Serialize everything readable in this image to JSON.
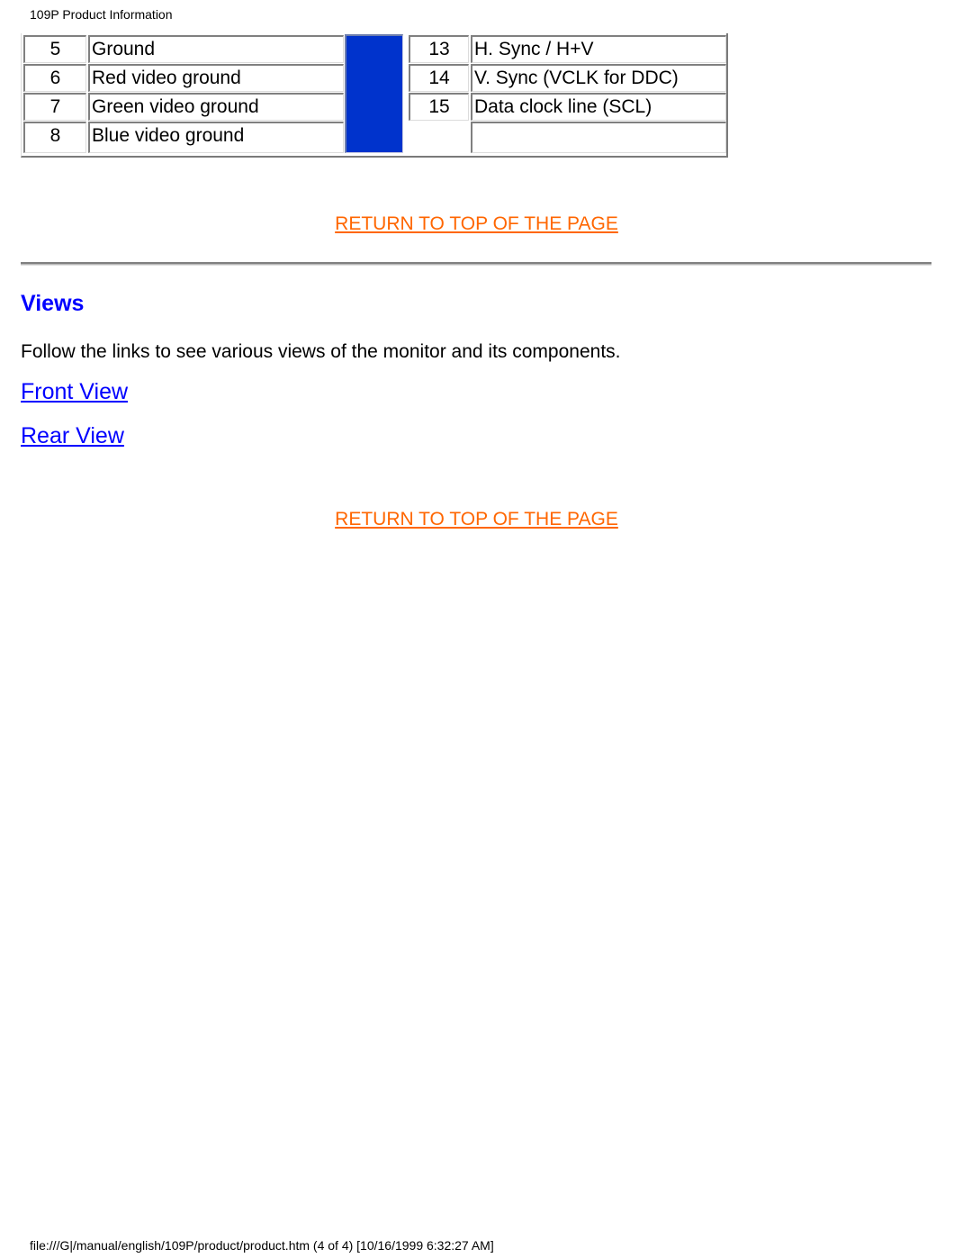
{
  "page_header": "109P Product Information",
  "pin_table": {
    "left_rows": [
      {
        "pin": "5",
        "signal": "Ground"
      },
      {
        "pin": "6",
        "signal": "Red video ground"
      },
      {
        "pin": "7",
        "signal": "Green video ground"
      },
      {
        "pin": "8",
        "signal": "Blue video ground"
      }
    ],
    "right_rows": [
      {
        "pin": "13",
        "signal": "H. Sync / H+V"
      },
      {
        "pin": "14",
        "signal": "V. Sync (VCLK for DDC)"
      },
      {
        "pin": "15",
        "signal": "Data clock line (SCL)"
      },
      {
        "pin": "",
        "signal": ""
      }
    ],
    "divider_color": "#0033cc"
  },
  "return_link_label": "RETURN TO TOP OF THE PAGE",
  "views": {
    "title": "Views",
    "intro": "Follow the links to see various views of the monitor and its components.",
    "links": [
      {
        "label": "Front View"
      },
      {
        "label": "Rear View"
      }
    ]
  },
  "footer": "file:///G|/manual/english/109P/product/product.htm (4 of 4) [10/16/1999 6:32:27 AM]",
  "colors": {
    "link": "#0000ff",
    "return_link": "#ff6600",
    "heading": "#0000ff"
  }
}
